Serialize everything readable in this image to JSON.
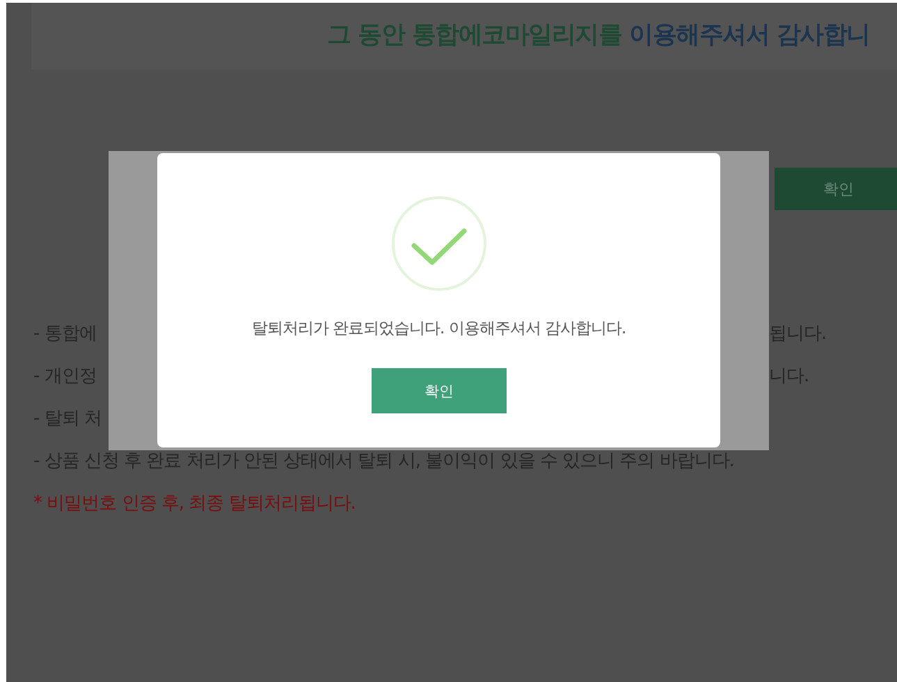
{
  "header": {
    "title_parts": [
      {
        "kind": "brand",
        "text": "그 동안 통합에코마일리지를"
      },
      {
        "kind": "accent",
        "text": "이용해주셔서 감사합니"
      }
    ]
  },
  "confirm_button": {
    "label": "확인"
  },
  "notices": [
    {
      "kind": "note",
      "left": "- 통합에",
      "right": "됩니다."
    },
    {
      "kind": "note",
      "left": "- 개인정",
      "right": "니다."
    },
    {
      "kind": "note",
      "left": "- 탈퇴 처"
    },
    {
      "kind": "note",
      "left": "- 상품 신청 후 완료 처리가 안된 상태에서 탈퇴 시, 불이익이 있을 수 있으니 주의 바랍니다."
    },
    {
      "kind": "warning",
      "left": "* 비밀번호 인증 후, 최종 탈퇴처리됩니다."
    }
  ],
  "dialog": {
    "message": "탈퇴처리가 완료되었습니다. 이용해주셔서 감사합니다.",
    "button": "확인"
  }
}
